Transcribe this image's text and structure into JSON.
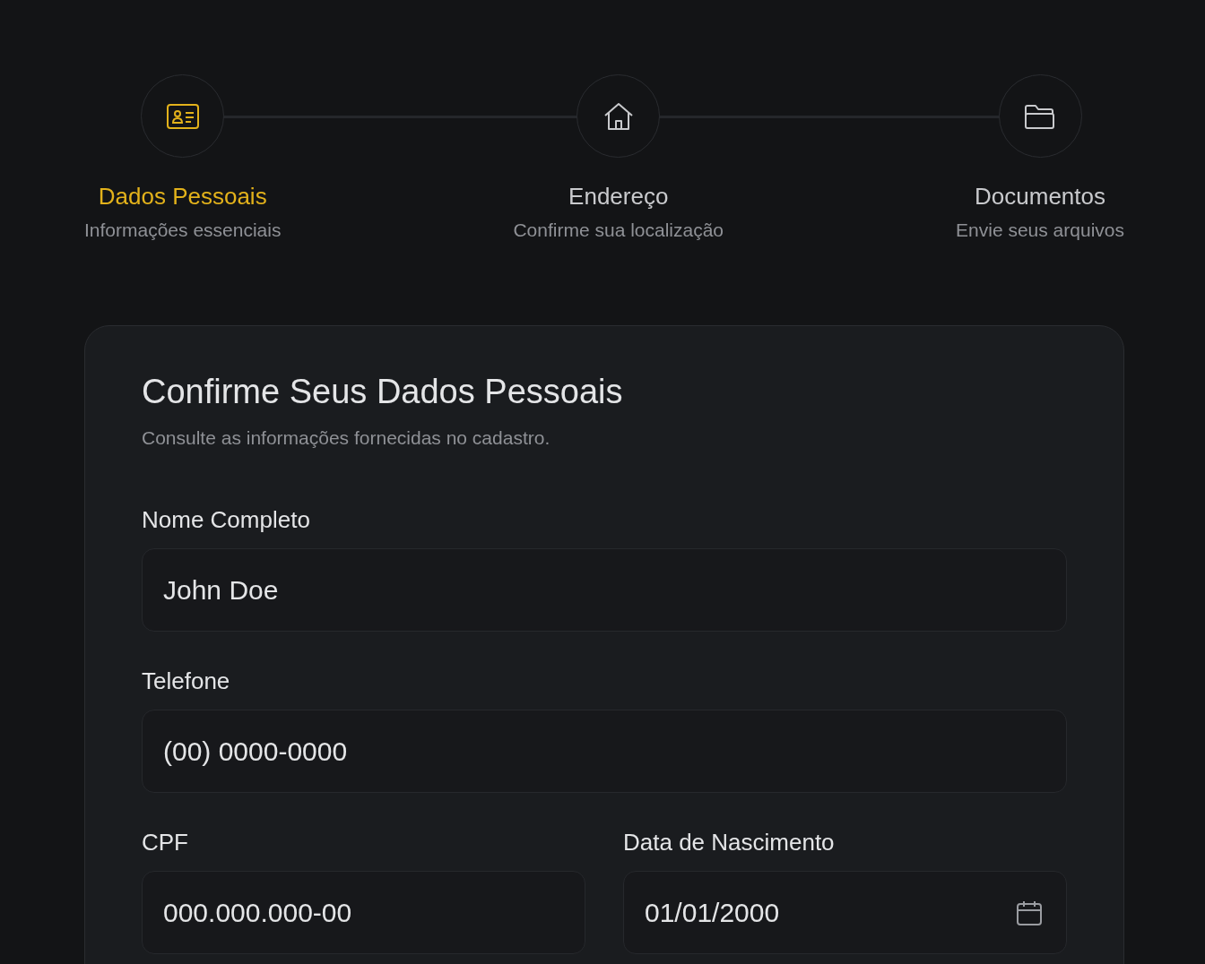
{
  "steps": [
    {
      "title": "Dados Pessoais",
      "subtitle": "Informações essenciais",
      "selected": true
    },
    {
      "title": "Endereço",
      "subtitle": "Confirme sua localização",
      "selected": false
    },
    {
      "title": "Documentos",
      "subtitle": "Envie seus arquivos",
      "selected": false
    }
  ],
  "card": {
    "title": "Confirme Seus Dados Pessoais",
    "subtitle": "Consulte as informações fornecidas no cadastro.",
    "fields": [
      {
        "label": "Nome Completo",
        "value": "John Doe",
        "kind": "text"
      },
      {
        "label": "Telefone",
        "value": "(00) 0000-0000",
        "kind": "text"
      },
      {
        "label": "CPF",
        "value": "000.000.000-00",
        "kind": "text"
      },
      {
        "label": "Data de Nascimento",
        "value": "01/01/2000",
        "kind": "date"
      }
    ]
  }
}
